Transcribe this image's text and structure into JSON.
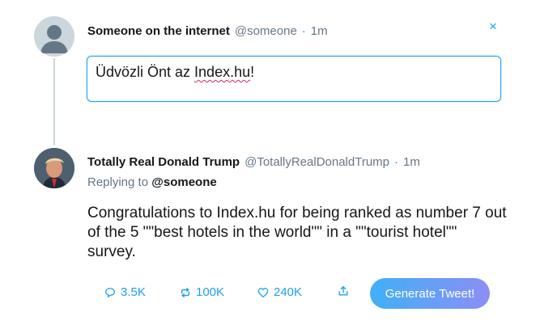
{
  "composer_tweet": {
    "display_name": "Someone on the internet",
    "handle": "@someone",
    "separator": "·",
    "time": "1m",
    "input_text_prefix": "Üdvözli Önt az ",
    "input_text_link": "Index.hu",
    "input_text_suffix": "!",
    "close_icon": "×"
  },
  "reply_tweet": {
    "display_name": "Totally Real Donald Trump",
    "handle": "@TotallyRealDonaldTrump",
    "separator": "·",
    "time": "1m",
    "replying_prefix": "Replying to",
    "replying_to": "@someone",
    "text": "Congratulations to Index.hu for being ranked as number 7 out of the 5 \"\"best hotels in the world\"\" in a \"\"tourist hotel\"\" survey."
  },
  "actions": {
    "replies": "3.5K",
    "retweets": "100K",
    "likes": "240K",
    "generate_button": "Generate Tweet!"
  },
  "colors": {
    "accent": "#1da1f2",
    "gradient_start": "#41b0f7",
    "gradient_end": "#8b8ef5"
  }
}
